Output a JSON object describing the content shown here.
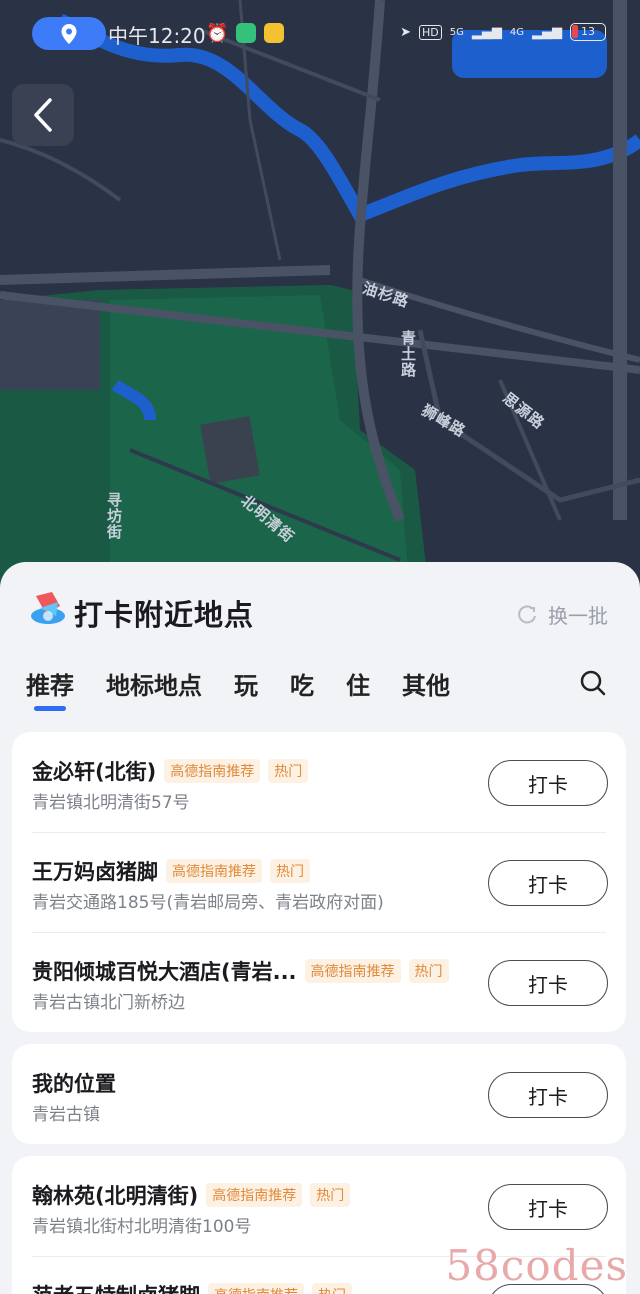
{
  "status_bar": {
    "time": "中午12:20",
    "network_left": "HD",
    "network_5g": "5G",
    "network_4g": "4G",
    "battery": "13"
  },
  "map": {
    "road_labels": [
      "油杉路",
      "青土路",
      "狮峰路",
      "思源路",
      "寻坊街",
      "北明清街"
    ]
  },
  "sheet": {
    "title": "打卡附近地点",
    "refresh_label": "换一批",
    "tabs": [
      "推荐",
      "地标地点",
      "玩",
      "吃",
      "住",
      "其他"
    ]
  },
  "places_group1": [
    {
      "name": "金必轩(北街)",
      "tags": [
        "高德指南推荐",
        "热门"
      ],
      "address": "青岩镇北明清街57号",
      "button": "打卡"
    },
    {
      "name": "王万妈卤猪脚",
      "tags": [
        "高德指南推荐",
        "热门"
      ],
      "address": "青岩交通路185号(青岩邮局旁、青岩政府对面)",
      "button": "打卡"
    },
    {
      "name": "贵阳倾城百悦大酒店(青岩...",
      "tags": [
        "高德指南推荐",
        "热门"
      ],
      "address": "青岩古镇北门新桥边",
      "button": "打卡"
    }
  ],
  "my_location": {
    "name": "我的位置",
    "address": "青岩古镇",
    "button": "打卡"
  },
  "places_group2": [
    {
      "name": "翰林苑(北明清街)",
      "tags": [
        "高德指南推荐",
        "热门"
      ],
      "address": "青岩镇北街村北明清街100号",
      "button": "打卡"
    },
    {
      "name": "范老五特制卤猪脚",
      "tags": [
        "高德指南推荐",
        "热门"
      ],
      "address": "",
      "button": "打卡"
    }
  ],
  "watermark": "58codes"
}
